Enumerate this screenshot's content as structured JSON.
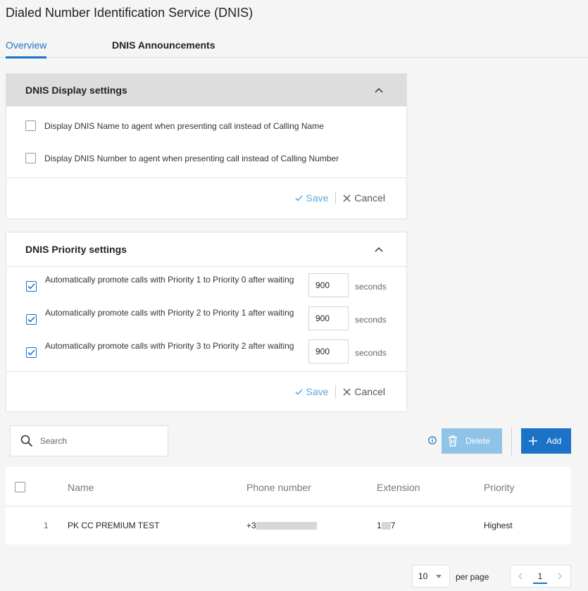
{
  "page": {
    "title": "Dialed Number Identification Service (DNIS)"
  },
  "tabs": [
    {
      "label": "Overview",
      "active": true
    },
    {
      "label": "DNIS Announcements",
      "active": false
    }
  ],
  "display_settings": {
    "title": "DNIS Display settings",
    "options": [
      {
        "label": "Display DNIS Name to agent when presenting call instead of Calling Name",
        "checked": false
      },
      {
        "label": "Display DNIS Number to agent when presenting call instead of Calling Number",
        "checked": false
      }
    ],
    "save_label": "Save",
    "cancel_label": "Cancel"
  },
  "priority_settings": {
    "title": "DNIS Priority settings",
    "rules": [
      {
        "text": "Automatically promote calls with Priority 1 to Priority 0 after waiting",
        "value": "900",
        "unit": "seconds",
        "checked": true
      },
      {
        "text": "Automatically promote calls with Priority 2 to Priority 1 after waiting",
        "value": "900",
        "unit": "seconds",
        "checked": true
      },
      {
        "text": "Automatically promote calls with Priority 3 to Priority 2 after waiting",
        "value": "900",
        "unit": "seconds",
        "checked": true
      }
    ],
    "save_label": "Save",
    "cancel_label": "Cancel"
  },
  "toolbar": {
    "search_placeholder": "Search",
    "delete_label": "Delete",
    "add_label": "Add"
  },
  "table": {
    "columns": [
      "Name",
      "Phone number",
      "Extension",
      "Priority"
    ],
    "rows": [
      {
        "index": "1",
        "name": "PK CC PREMIUM TEST",
        "phone": "+3",
        "extension_start": "1",
        "extension_end": "7",
        "priority": "Highest"
      }
    ]
  },
  "pagination": {
    "per_page_value": "10",
    "per_page_label": "per page",
    "current_page": "1"
  },
  "colors": {
    "accent": "#1a73c7",
    "accent_light": "#8fc3e8",
    "header_grey": "#dddddd"
  }
}
